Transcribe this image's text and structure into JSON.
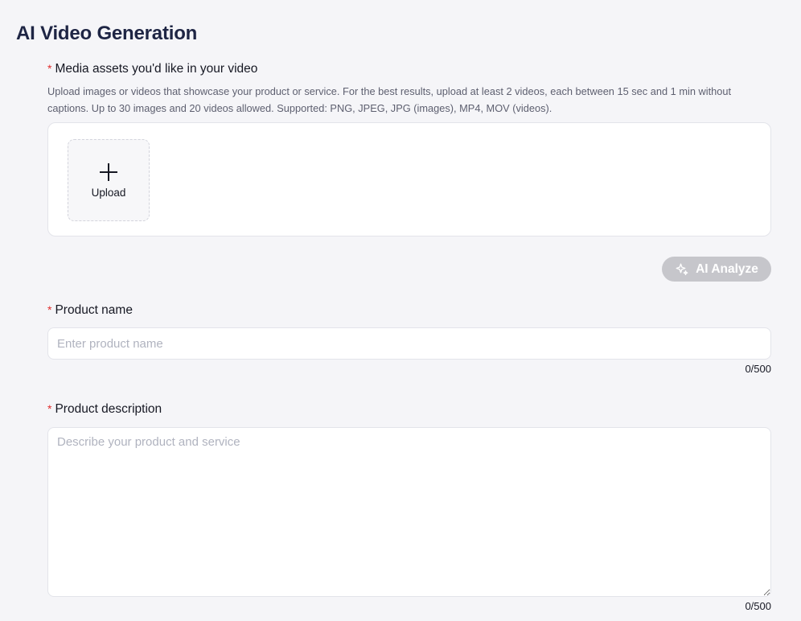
{
  "page": {
    "title": "AI Video Generation"
  },
  "media": {
    "required_mark": "*",
    "label": "Media assets you'd like in your video",
    "hint": "Upload images or videos that showcase your product or service. For the best results, upload at least 2 videos, each between 15 sec and 1 min without captions. Up to 30 images and 20 videos allowed. Supported: PNG, JPEG, JPG (images), MP4, MOV (videos).",
    "upload_label": "Upload",
    "upload_icon": "plus-icon"
  },
  "analyze": {
    "label": "AI Analyze",
    "icon": "sparkle-icon",
    "state": "disabled"
  },
  "product_name": {
    "required_mark": "*",
    "label": "Product name",
    "value": "",
    "placeholder": "Enter product name",
    "counter": "0/500"
  },
  "product_description": {
    "required_mark": "*",
    "label": "Product description",
    "value": "",
    "placeholder": "Describe your product and service",
    "counter": "0/500"
  },
  "colors": {
    "background": "#f5f5f8",
    "required": "#e02d2d",
    "disabled_button": "#c6c6cb",
    "title": "#1e2544"
  }
}
